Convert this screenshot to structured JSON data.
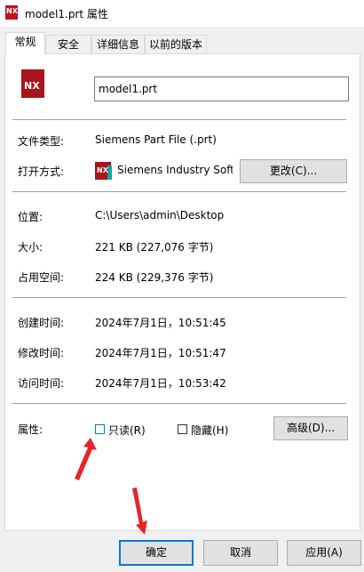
{
  "window": {
    "title": "model1.prt 属性"
  },
  "tabs": [
    {
      "label": "常规",
      "active": true
    },
    {
      "label": "安全",
      "active": false
    },
    {
      "label": "详细信息",
      "active": false
    },
    {
      "label": "以前的版本",
      "active": false
    }
  ],
  "file": {
    "name": "model1.prt",
    "icon_text": "NX"
  },
  "general": {
    "type_label": "文件类型:",
    "type_value": "Siemens Part File (.prt)",
    "open_with_label": "打开方式:",
    "open_with_value": "Siemens Industry Softw",
    "change_button": "更改(C)...",
    "location_label": "位置:",
    "location_value": "C:\\Users\\admin\\Desktop",
    "size_label": "大小:",
    "size_value": "221 KB (227,076 字节)",
    "disk_size_label": "占用空间:",
    "disk_size_value": "224 KB (229,376 字节)",
    "created_label": "创建时间:",
    "created_value": "2024年7月1日，10:51:45",
    "modified_label": "修改时间:",
    "modified_value": "2024年7月1日，10:51:47",
    "accessed_label": "访问时间:",
    "accessed_value": "2024年7月1日，10:53:42",
    "attributes_label": "属性:",
    "readonly_label": "只读(R)",
    "readonly_checked": false,
    "hidden_label": "隐藏(H)",
    "hidden_checked": false,
    "advanced_button": "高级(D)..."
  },
  "footer": {
    "ok": "确定",
    "cancel": "取消",
    "apply": "应用(A)"
  },
  "colors": {
    "accent": "#0078d7",
    "nx_red": "#a8151d",
    "arrow_red": "#e8232a"
  }
}
